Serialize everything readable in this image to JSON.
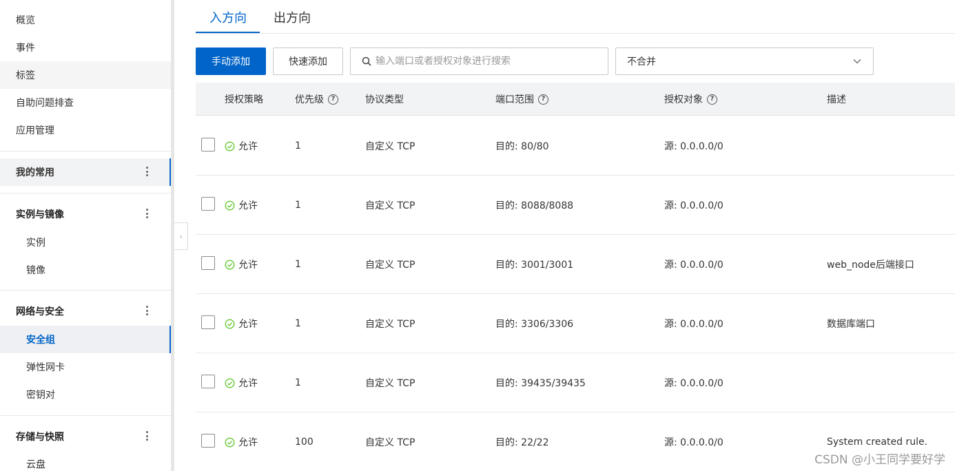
{
  "sidebar": {
    "top_items": [
      "概览",
      "事件",
      "标签",
      "自助问题排查",
      "应用管理"
    ],
    "favorites": {
      "label": "我的常用"
    },
    "instances": {
      "label": "实例与镜像",
      "items": [
        "实例",
        "镜像"
      ]
    },
    "network": {
      "label": "网络与安全",
      "items": [
        "安全组",
        "弹性网卡",
        "密钥对"
      ]
    },
    "storage": {
      "label": "存储与快照",
      "items": [
        "云盘"
      ]
    }
  },
  "tabs": [
    "入方向",
    "出方向"
  ],
  "toolbar": {
    "manual_add": "手动添加",
    "quick_add": "快速添加",
    "search_placeholder": "输入端口或者授权对象进行搜索",
    "merge_select": "不合并"
  },
  "columns": [
    "授权策略",
    "优先级",
    "协议类型",
    "端口范围",
    "授权对象",
    "描述"
  ],
  "rows": [
    {
      "policy": "允许",
      "priority": "1",
      "protocol": "自定义 TCP",
      "port": "目的: 80/80",
      "source": "源: 0.0.0.0/0",
      "desc": ""
    },
    {
      "policy": "允许",
      "priority": "1",
      "protocol": "自定义 TCP",
      "port": "目的: 8088/8088",
      "source": "源: 0.0.0.0/0",
      "desc": ""
    },
    {
      "policy": "允许",
      "priority": "1",
      "protocol": "自定义 TCP",
      "port": "目的: 3001/3001",
      "source": "源: 0.0.0.0/0",
      "desc": "web_node后端接口"
    },
    {
      "policy": "允许",
      "priority": "1",
      "protocol": "自定义 TCP",
      "port": "目的: 3306/3306",
      "source": "源: 0.0.0.0/0",
      "desc": "数据库端口"
    },
    {
      "policy": "允许",
      "priority": "1",
      "protocol": "自定义 TCP",
      "port": "目的: 39435/39435",
      "source": "源: 0.0.0.0/0",
      "desc": ""
    },
    {
      "policy": "允许",
      "priority": "100",
      "protocol": "自定义 TCP",
      "port": "目的: 22/22",
      "source": "源: 0.0.0.0/0",
      "desc": "System created rule."
    }
  ],
  "watermark": "CSDN @小王同学要好学",
  "colors": {
    "accent": "#0064c8",
    "allow": "#52c41a"
  }
}
